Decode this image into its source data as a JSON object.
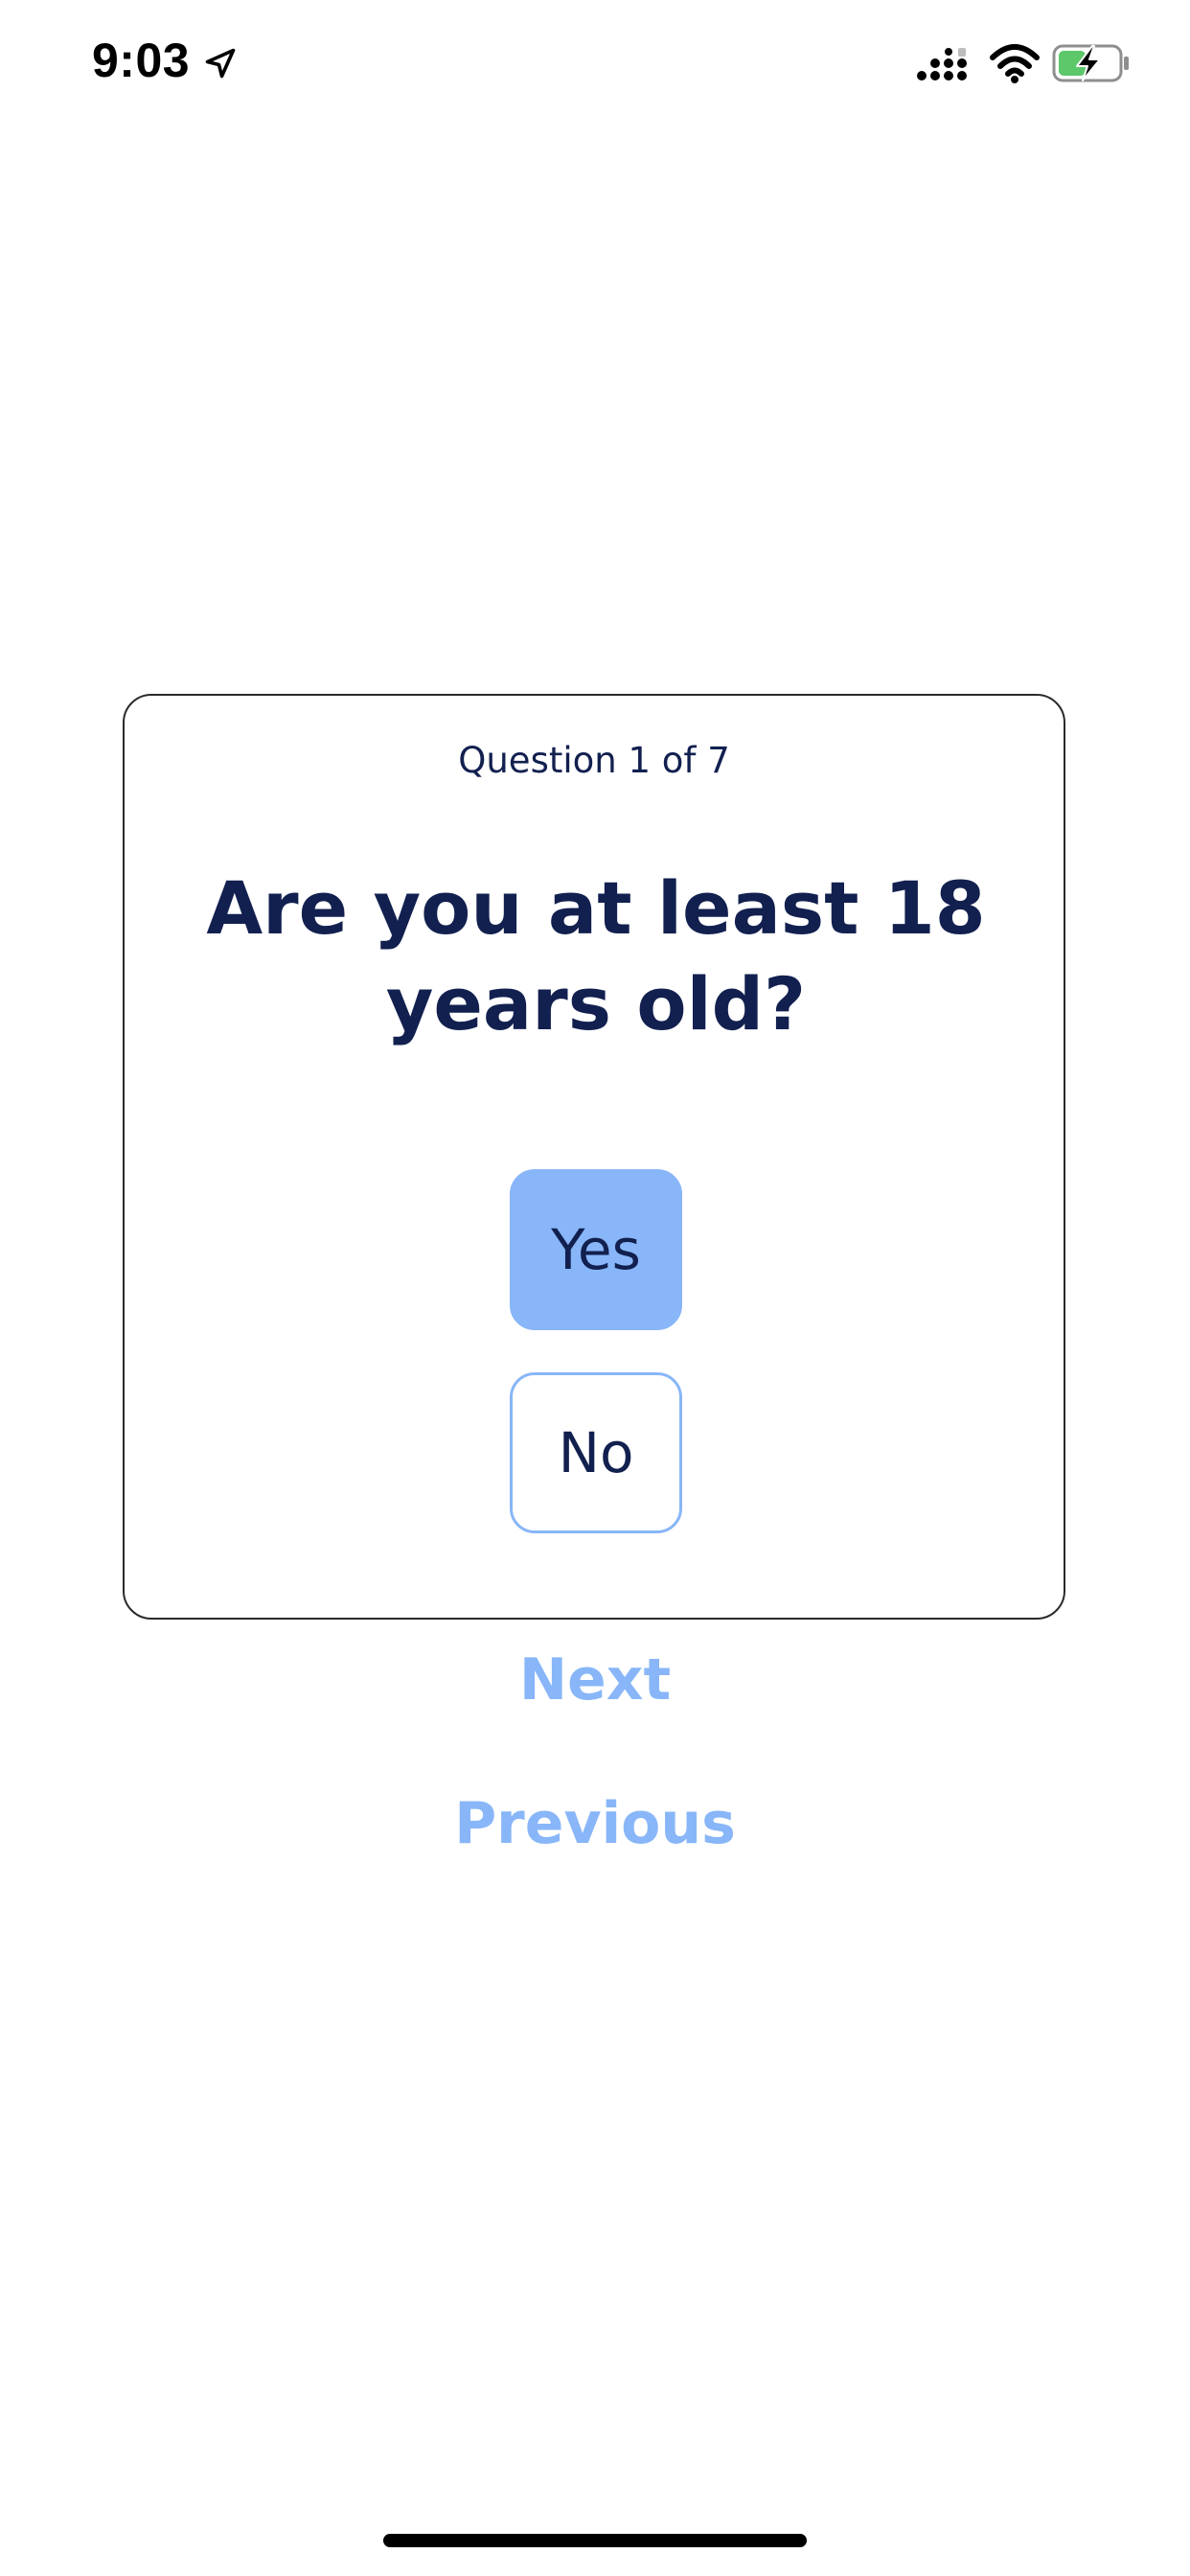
{
  "status_bar": {
    "time": "9:03",
    "icons": [
      "location-arrow-icon",
      "cellular-signal-icon",
      "wifi-icon",
      "battery-charging-icon"
    ],
    "battery_color": "#5cc86a"
  },
  "quiz": {
    "counter": "Question 1 of 7",
    "question": "Are you at least 18 years old?",
    "answers": {
      "yes": "Yes",
      "no": "No"
    },
    "selected": "Yes"
  },
  "navigation": {
    "next": "Next",
    "previous": "Previous"
  },
  "colors": {
    "primary_text": "#12204f",
    "accent": "#88b6f8"
  }
}
